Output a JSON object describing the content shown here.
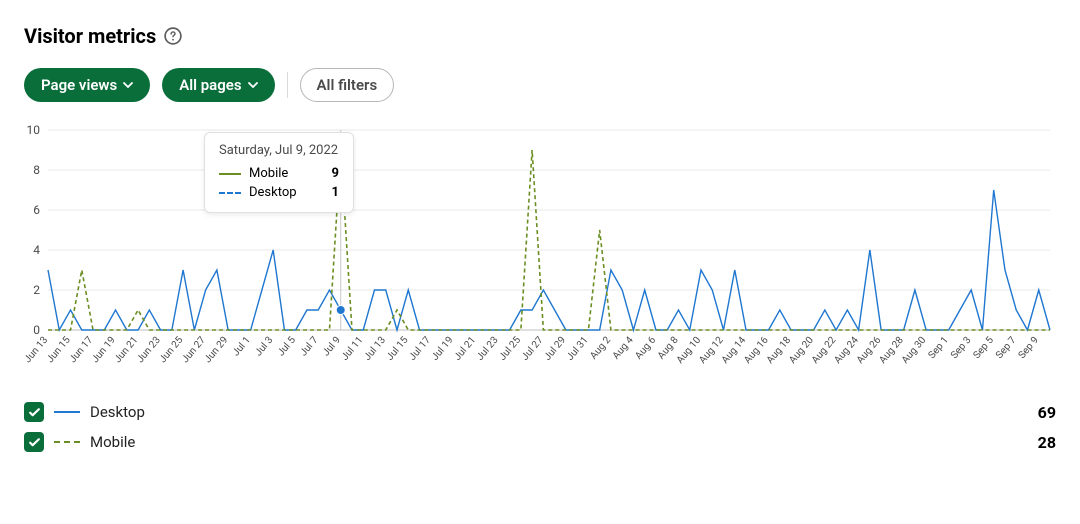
{
  "title": "Visitor metrics",
  "filters": {
    "metric": "Page views",
    "pages": "All pages",
    "all_filters": "All filters"
  },
  "tooltip": {
    "date": "Saturday, Jul 9, 2022",
    "rows": [
      {
        "name": "Mobile",
        "value": 9,
        "style": "solid-green"
      },
      {
        "name": "Desktop",
        "value": 1,
        "style": "dashed-blue"
      }
    ]
  },
  "legend": {
    "desktop": {
      "name": "Desktop",
      "total": 69
    },
    "mobile": {
      "name": "Mobile",
      "total": 28
    }
  },
  "chart_data": {
    "type": "line",
    "ylabel": "",
    "xlabel": "",
    "ylim": [
      0,
      10
    ],
    "yticks": [
      0,
      2,
      4,
      6,
      8,
      10
    ],
    "categories": [
      "Jun 13",
      "Jun 14",
      "Jun 15",
      "Jun 16",
      "Jun 17",
      "Jun 18",
      "Jun 19",
      "Jun 20",
      "Jun 21",
      "Jun 22",
      "Jun 23",
      "Jun 24",
      "Jun 25",
      "Jun 26",
      "Jun 27",
      "Jun 28",
      "Jun 29",
      "Jun 30",
      "Jul 1",
      "Jul 2",
      "Jul 3",
      "Jul 4",
      "Jul 5",
      "Jul 6",
      "Jul 7",
      "Jul 8",
      "Jul 9",
      "Jul 10",
      "Jul 11",
      "Jul 12",
      "Jul 13",
      "Jul 14",
      "Jul 15",
      "Jul 16",
      "Jul 17",
      "Jul 18",
      "Jul 19",
      "Jul 20",
      "Jul 21",
      "Jul 22",
      "Jul 23",
      "Jul 24",
      "Jul 25",
      "Jul 26",
      "Jul 27",
      "Jul 28",
      "Jul 29",
      "Jul 30",
      "Jul 31",
      "Aug 1",
      "Aug 2",
      "Aug 3",
      "Aug 4",
      "Aug 5",
      "Aug 6",
      "Aug 7",
      "Aug 8",
      "Aug 9",
      "Aug 10",
      "Aug 11",
      "Aug 12",
      "Aug 13",
      "Aug 14",
      "Aug 15",
      "Aug 16",
      "Aug 17",
      "Aug 18",
      "Aug 19",
      "Aug 20",
      "Aug 21",
      "Aug 22",
      "Aug 23",
      "Aug 24",
      "Aug 25",
      "Aug 26",
      "Aug 27",
      "Aug 28",
      "Aug 29",
      "Aug 30",
      "Aug 31",
      "Sep 1",
      "Sep 2",
      "Sep 3",
      "Sep 4",
      "Sep 5",
      "Sep 6",
      "Sep 7",
      "Sep 8",
      "Sep 9",
      "Sep 10"
    ],
    "xtick_labels": [
      "Jun 13",
      "Jun 15",
      "Jun 17",
      "Jun 19",
      "Jun 21",
      "Jun 23",
      "Jun 25",
      "Jun 27",
      "Jun 29",
      "Jul 1",
      "Jul 3",
      "Jul 5",
      "Jul 7",
      "Jul 9",
      "Jul 11",
      "Jul 13",
      "Jul 15",
      "Jul 17",
      "Jul 19",
      "Jul 21",
      "Jul 23",
      "Jul 25",
      "Jul 27",
      "Jul 29",
      "Jul 31",
      "Aug 2",
      "Aug 4",
      "Aug 6",
      "Aug 8",
      "Aug 10",
      "Aug 12",
      "Aug 14",
      "Aug 16",
      "Aug 18",
      "Aug 20",
      "Aug 22",
      "Aug 24",
      "Aug 26",
      "Aug 28",
      "Aug 30",
      "Sep 1",
      "Sep 3",
      "Sep 5",
      "Sep 7",
      "Sep 9"
    ],
    "series": [
      {
        "name": "Desktop",
        "color": "#1f77d0",
        "dash": false,
        "values": [
          3,
          0,
          1,
          0,
          0,
          0,
          1,
          0,
          0,
          1,
          0,
          0,
          3,
          0,
          2,
          3,
          0,
          0,
          0,
          2,
          4,
          0,
          0,
          1,
          1,
          2,
          1,
          0,
          0,
          2,
          2,
          0,
          2,
          0,
          0,
          0,
          0,
          0,
          0,
          0,
          0,
          0,
          1,
          1,
          2,
          1,
          0,
          0,
          0,
          0,
          3,
          2,
          0,
          2,
          0,
          0,
          1,
          0,
          3,
          2,
          0,
          3,
          0,
          0,
          0,
          1,
          0,
          0,
          0,
          1,
          0,
          1,
          0,
          4,
          0,
          0,
          0,
          2,
          0,
          0,
          0,
          1,
          2,
          0,
          7,
          3,
          1,
          0,
          2,
          0
        ]
      },
      {
        "name": "Mobile",
        "color": "#6b8e23",
        "dash": true,
        "values": [
          0,
          0,
          0,
          3,
          0,
          0,
          0,
          0,
          1,
          0,
          0,
          0,
          0,
          0,
          0,
          0,
          0,
          0,
          0,
          0,
          0,
          0,
          0,
          0,
          0,
          0,
          9,
          0,
          0,
          0,
          0,
          1,
          0,
          0,
          0,
          0,
          0,
          0,
          0,
          0,
          0,
          0,
          0,
          9,
          0,
          0,
          0,
          0,
          0,
          5,
          0,
          0,
          0,
          0,
          0,
          0,
          0,
          0,
          0,
          0,
          0,
          0,
          0,
          0,
          0,
          0,
          0,
          0,
          0,
          0,
          0,
          0,
          0,
          0,
          0,
          0,
          0,
          0,
          0,
          0,
          0,
          0,
          0,
          0,
          0,
          0,
          0,
          0,
          0,
          0
        ]
      }
    ]
  }
}
